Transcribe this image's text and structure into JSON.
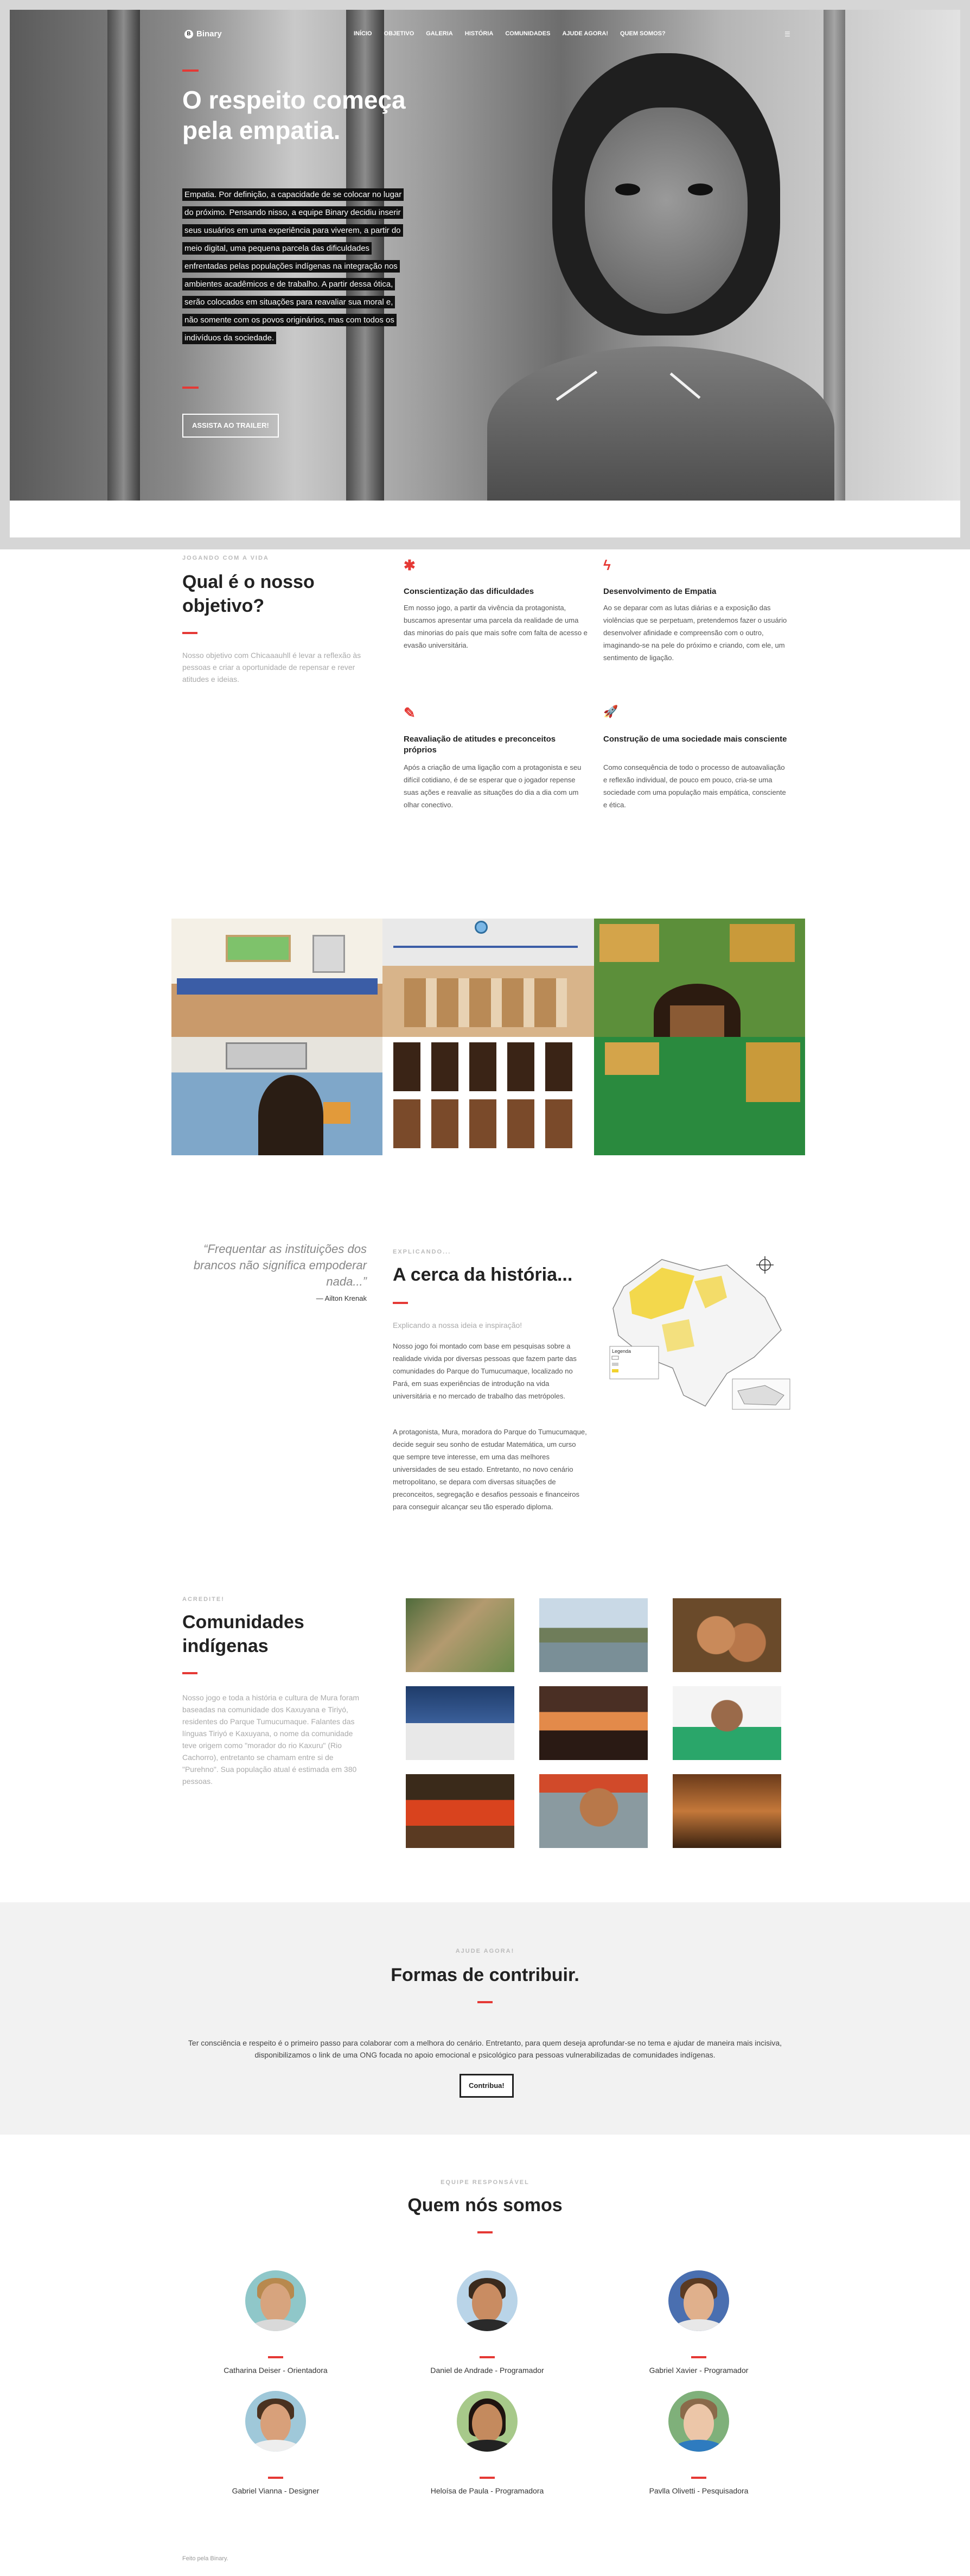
{
  "nav": {
    "brand": "Binary",
    "brand_icon": "circle-b-icon",
    "items": [
      "INÍCIO",
      "OBJETIVO",
      "GALERIA",
      "HISTÓRIA",
      "COMUNIDADES",
      "AJUDE AGORA!",
      "QUEM SOMOS?"
    ],
    "menu_icon": "list-icon"
  },
  "hero": {
    "title": "O respeito começa pela empatia.",
    "text": "Empatia. Por definição, a capacidade de se colocar no lugar do próximo. Pensando nisso, a equipe Binary decidiu inserir seus usuários em uma experiência para viverem, a partir do meio digital, uma pequena parcela das dificuldades enfrentadas pelas populações indígenas na integração nos ambientes acadêmicos e de trabalho. A partir dessa ótica, serão colocados em situações para reavaliar sua moral e, não somente com os povos originários, mas com todos os indivíduos da sociedade.",
    "button": "ASSISTA AO TRAILER!"
  },
  "objective": {
    "eyebrow": "Jogando com a vida",
    "title": "Qual é o nosso objetivo?",
    "lead": "Nosso objetivo com Chicaaauhll é levar a reflexão às pessoas e criar a oportunidade de repensar e rever atitudes e ideias.",
    "features": [
      {
        "icon": "asterisk-icon",
        "glyph": "✱",
        "title": "Conscientização das dificuldades",
        "text": "Em nosso jogo, a partir da vivência da protagonista, buscamos apresentar uma parcela da realidade de uma das minorias do país que mais sofre com falta de acesso e evasão universitária."
      },
      {
        "icon": "bolt-icon",
        "glyph": "ϟ",
        "title": "Desenvolvimento de Empatia",
        "text": "Ao se deparar com as lutas diárias e a exposição das violências que se perpetuam, pretendemos fazer o usuário desenvolver afinidade e compreensão com o outro, imaginando-se na pele do próximo e criando, com ele, um sentimento de ligação."
      },
      {
        "icon": "edit-icon",
        "glyph": "✎",
        "title": "Reavaliação de atitudes e preconceitos próprios",
        "text": "Após a criação de uma ligação com a protagonista e seu difícil cotidiano, é de se esperar que o jogador repense suas ações e reavalie as situações do dia a dia com um olhar conectivo."
      },
      {
        "icon": "rocket-icon",
        "glyph": "🚀",
        "title": "Construção de uma sociedade mais consciente",
        "text": "Como consequência de todo o processo de autoavaliação e reflexão individual, de pouco em pouco, cria-se uma sociedade com uma população mais empática, consciente e ética."
      }
    ]
  },
  "history": {
    "quote": "“Frequentar as instituições dos brancos não significa empoderar nada...”",
    "quote_author": "— Ailton Krenak",
    "eyebrow": "Explicando...",
    "title": "A cerca da história...",
    "subtitle": "Explicando a nossa ideia e inspiração!",
    "p1": "Nosso jogo foi montado com base em pesquisas sobre a realidade vivida por diversas pessoas que fazem parte das comunidades do Parque do Tumucumaque, localizado no Pará, em suas experiências de introdução na vida universitária e no mercado de trabalho das metrópoles.",
    "p2": "A protagonista, Mura, moradora do Parque do Tumucumaque, decide seguir seu sonho de estudar Matemática, um curso que sempre teve interesse, em uma das melhores universidades de seu estado. Entretanto, no novo cenário metropolitano, se depara com diversas situações de preconceitos, segregação e desafios pessoais e financeiros para conseguir alcançar seu tão esperado diploma.",
    "map_legend_title": "Legenda"
  },
  "communities": {
    "eyebrow": "Acredite!",
    "title": "Comunidades indígenas",
    "text": "Nosso jogo e toda a história e cultura de Mura foram baseadas na comunidade dos Kaxuyana e Tiriyó, residentes do Parque Tumucumaque. Falantes das línguas Tiriyó e Kaxuyana, o nome da comunidade teve origem como \"morador do rio Kaxuru\" (Rio Cachorro), entretanto se chamam entre si de \"Purehno\". Sua população atual é estimada em 380 pessoas."
  },
  "contribute": {
    "eyebrow": "Ajude agora!",
    "title": "Formas de contribuir.",
    "text": "Ter consciência e respeito é o primeiro passo para colaborar com a melhora do cenário. Entretanto, para quem deseja aprofundar-se no tema e ajudar de maneira mais incisiva, disponibilizamos o link de uma ONG focada no apoio emocional e psicológico para pessoas vulnerabilizadas de comunidades indígenas.",
    "button": "Contribua!"
  },
  "team": {
    "eyebrow": "Equipe responsável",
    "title": "Quem nós somos",
    "members": [
      "Catharina Deiser - Orientadora",
      "Daniel de Andrade - Programador",
      "Gabriel Xavier - Programador",
      "Gabriel Vianna - Designer",
      "Heloísa de Paula - Programadora",
      "Pavlla Olivetti - Pesquisadora"
    ]
  },
  "footer": {
    "text": "Feito pela Binary."
  },
  "colors": {
    "accent": "#e53935",
    "dark": "#222222",
    "muted": "#aaaaaa",
    "band": "#f2f2f2"
  }
}
